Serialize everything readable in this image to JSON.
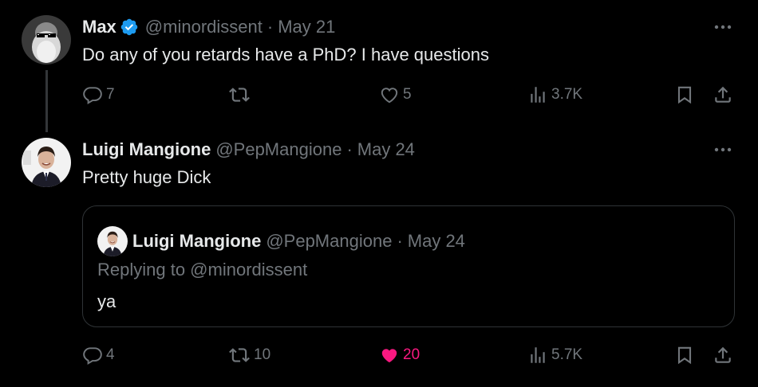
{
  "tweets": [
    {
      "author_name": "Max",
      "handle": "@minordissent",
      "separator": "·",
      "date": "May 21",
      "verified": true,
      "text": "Do any of you retards have a PhD? I have questions",
      "stats": {
        "replies": "7",
        "retweets": "",
        "likes": "5",
        "views": "3.7K"
      },
      "liked": false
    },
    {
      "author_name": "Luigi Mangione",
      "handle": "@PepMangione",
      "separator": "·",
      "date": "May 24",
      "verified": false,
      "text": "Pretty huge Dick",
      "quote": {
        "author_name": "Luigi Mangione",
        "handle": "@PepMangione",
        "separator": "·",
        "date": "May 24",
        "replying_to": "Replying to @minordissent",
        "text": "ya"
      },
      "stats": {
        "replies": "4",
        "retweets": "10",
        "likes": "20",
        "views": "5.7K"
      },
      "liked": true
    }
  ],
  "colors": {
    "background": "#000000",
    "text_primary": "#e7e9ea",
    "text_secondary": "#71767b",
    "verified_blue": "#1d9bf0",
    "like_pink": "#f91880",
    "border": "#2f3336"
  },
  "icons": [
    "verified-badge-icon",
    "more-icon",
    "reply-icon",
    "retweet-icon",
    "like-icon",
    "views-icon",
    "bookmark-icon",
    "share-icon"
  ]
}
